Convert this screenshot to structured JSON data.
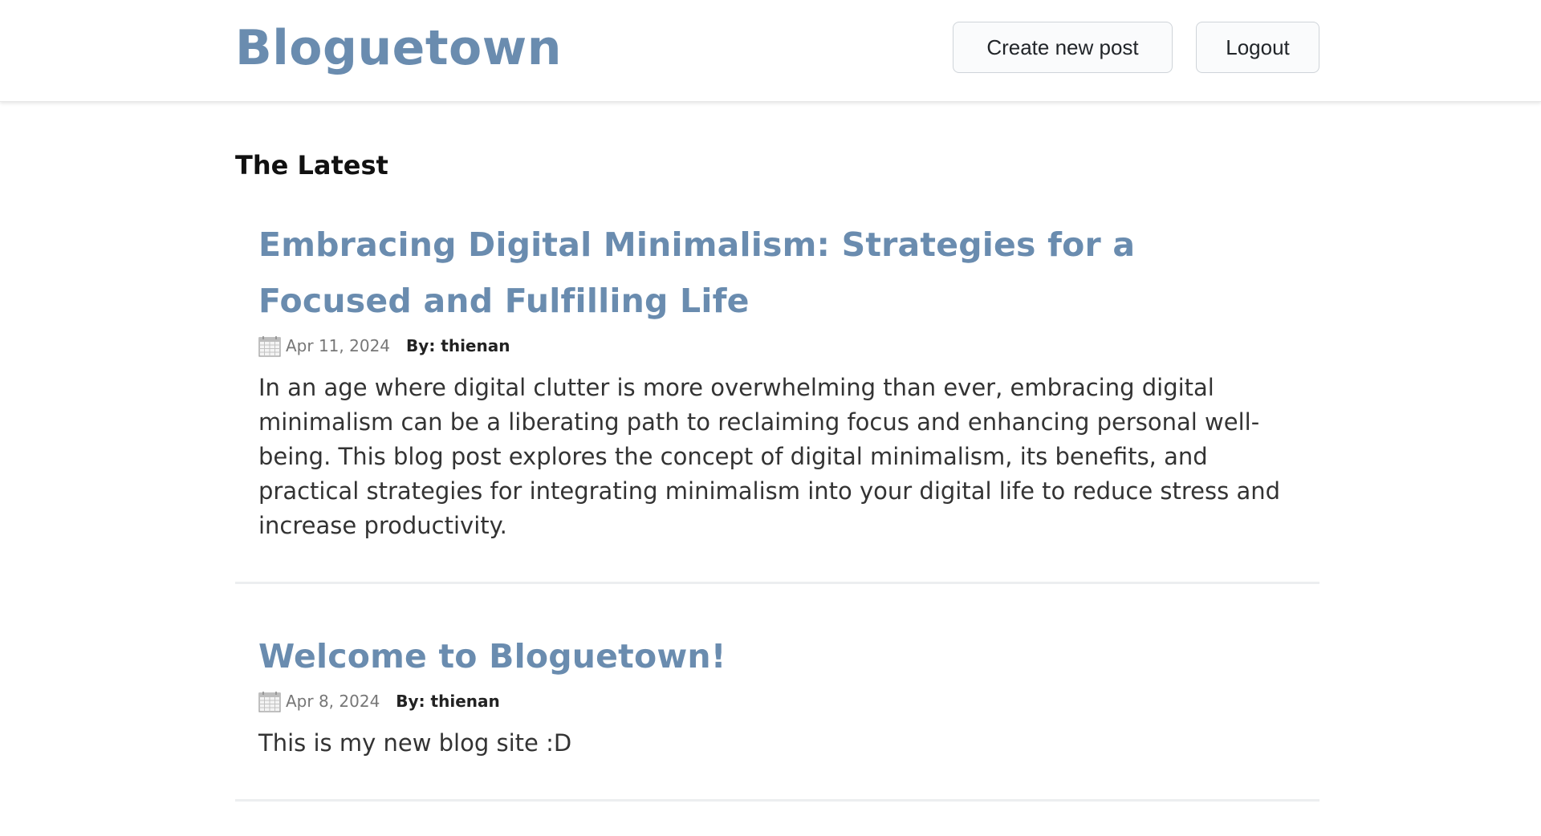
{
  "header": {
    "brand": "Bloguetown",
    "create_label": "Create new post",
    "logout_label": "Logout"
  },
  "main": {
    "section_title": "The Latest",
    "posts": [
      {
        "title": "Embracing Digital Minimalism: Strategies for a Focused and Fulfilling Life",
        "date": "Apr 11, 2024",
        "author": "By: thienan",
        "excerpt": "In an age where digital clutter is more overwhelming than ever, embracing digital minimalism can be a liberating path to reclaiming focus and enhancing personal well-being. This blog post explores the concept of digital minimalism, its benefits, and practical strategies for integrating minimalism into your digital life to reduce stress and increase productivity."
      },
      {
        "title": "Welcome to Bloguetown!",
        "date": "Apr 8, 2024",
        "author": "By: thienan",
        "excerpt": "This is my new blog site :D"
      }
    ]
  },
  "colors": {
    "brand": "#6a8caf",
    "divider": "#eceef0",
    "meta_date": "#777777"
  },
  "icons": {
    "date": "calendar-icon"
  }
}
